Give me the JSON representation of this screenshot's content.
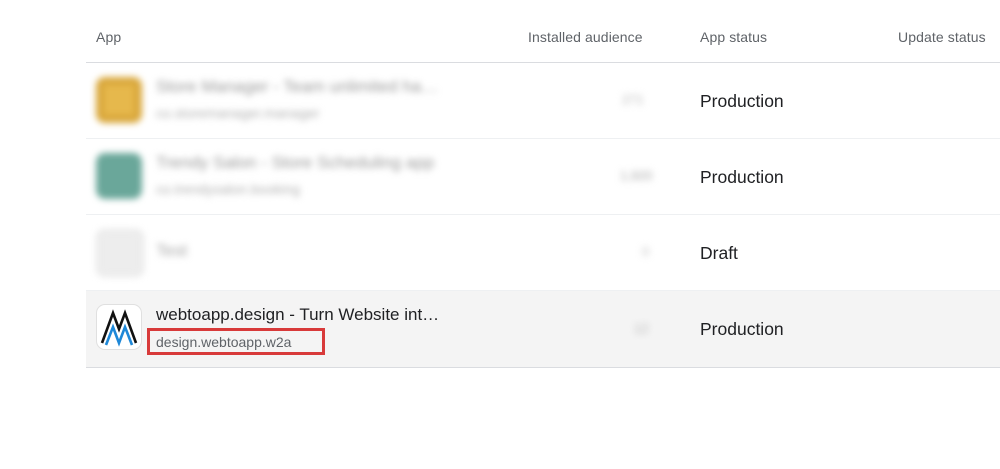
{
  "columns": {
    "app": "App",
    "installed_audience": "Installed audience",
    "app_status": "App status",
    "update_status": "Update status"
  },
  "rows": [
    {
      "name": "Store Manager - Team unlimited ha…",
      "package": "co.storemanager.manager",
      "audience": "271",
      "status": "Production",
      "icon_color": "#e6b84c"
    },
    {
      "name": "Trendy Salon - Store Scheduling app",
      "package": "co.trendysalon.booking",
      "audience": "1,920",
      "status": "Production",
      "icon_color": "#6aa79a"
    },
    {
      "name": "Test",
      "package": "",
      "audience": "0",
      "status": "Draft",
      "icon_color": "#e8e8e8"
    },
    {
      "name": "webtoapp.design - Turn Website int…",
      "package": "design.webtoapp.w2a",
      "audience": "12",
      "status": "Production",
      "icon_color": "#ffffff"
    }
  ],
  "highlight_color": "#d83a3a"
}
